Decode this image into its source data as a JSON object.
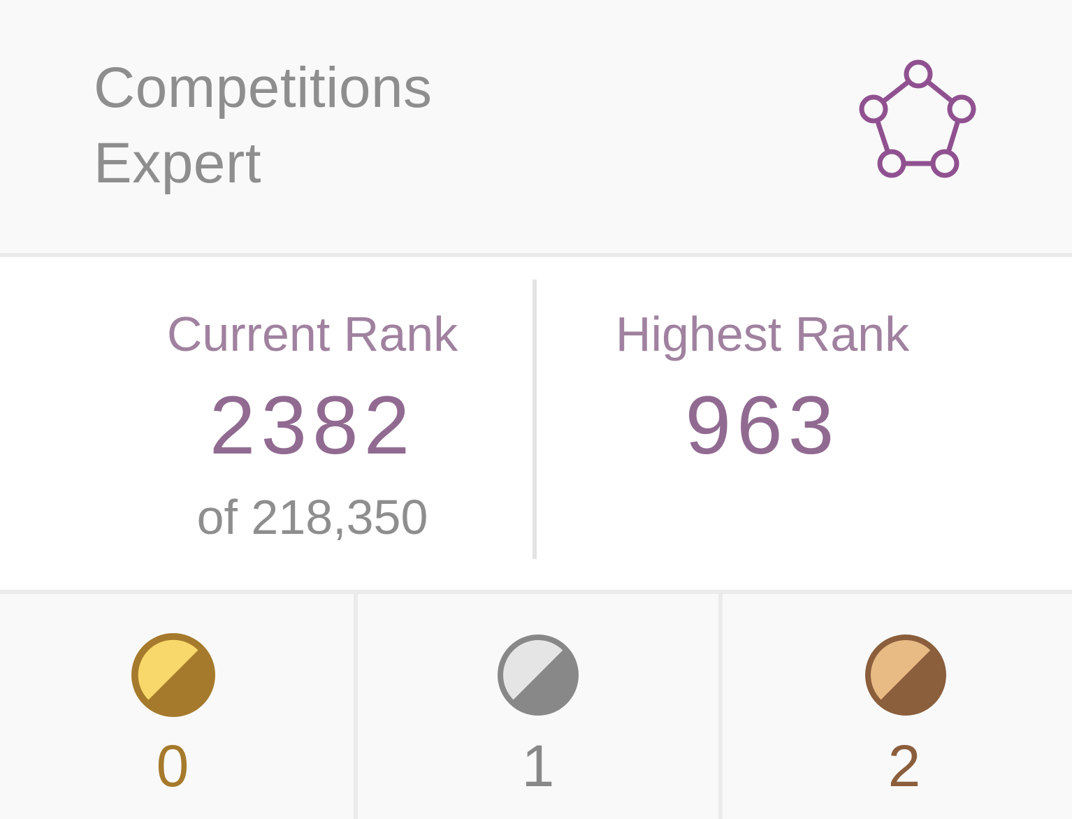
{
  "header": {
    "tier_line1": "Competitions",
    "tier_line2": "Expert",
    "tier_icon": "expert-tier-pentagon-icon",
    "tier_icon_color": "#905190"
  },
  "rank": {
    "current_label": "Current Rank",
    "current_value": "2382",
    "current_total": "of 218,350",
    "highest_label": "Highest Rank",
    "highest_value": "963"
  },
  "medals": {
    "gold": {
      "icon": "gold-medal-icon",
      "count": "0",
      "color": "#a67a2c"
    },
    "silver": {
      "icon": "silver-medal-icon",
      "count": "1",
      "color": "#888888"
    },
    "bronze": {
      "icon": "bronze-medal-icon",
      "count": "2",
      "color": "#8b5e3c"
    }
  },
  "colors": {
    "rank_label": "#a0819f",
    "rank_value": "#916a91",
    "muted_text": "#8e8e8e"
  }
}
